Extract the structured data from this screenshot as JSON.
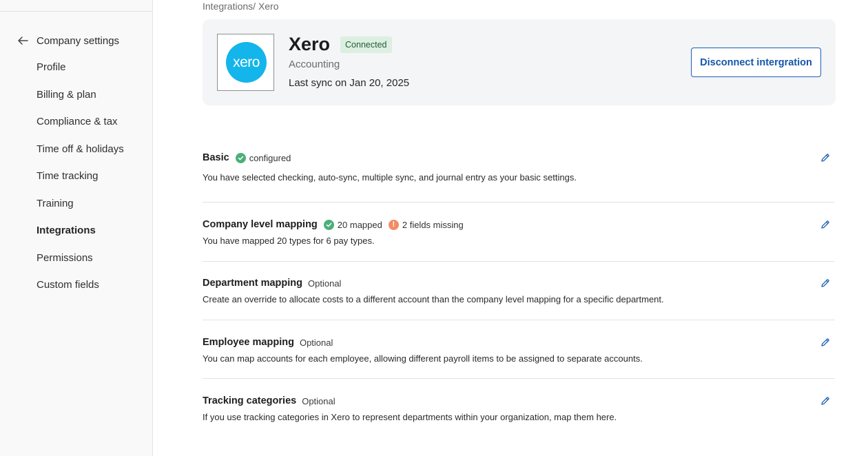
{
  "sidebar": {
    "back_label": "Company settings",
    "items": [
      {
        "label": "Profile"
      },
      {
        "label": "Billing & plan"
      },
      {
        "label": "Compliance & tax"
      },
      {
        "label": "Time off & holidays"
      },
      {
        "label": "Time tracking"
      },
      {
        "label": "Training"
      },
      {
        "label": "Integrations"
      },
      {
        "label": "Permissions"
      },
      {
        "label": "Custom fields"
      }
    ]
  },
  "breadcrumb": "Integrations/ Xero",
  "integration": {
    "logo_text": "xero",
    "name": "Xero",
    "badge": "Connected",
    "category": "Accounting",
    "last_sync": "Last sync on Jan 20, 2025",
    "disconnect_label": "Disconnect intergration"
  },
  "sections": [
    {
      "title": "Basic",
      "status_ok": "configured",
      "description": "You have selected checking, auto-sync, multiple sync, and journal entry as your basic settings."
    },
    {
      "title": "Company level mapping",
      "status_ok": "20 mapped",
      "status_warn_symbol": "!",
      "status_warn": "2 fields missing",
      "description": "You have mapped 20 types for 6 pay types."
    },
    {
      "title": "Department mapping",
      "meta": "Optional",
      "description": "Create an override to allocate costs to a different account than the company level mapping for a specific department."
    },
    {
      "title": "Employee mapping",
      "meta": "Optional",
      "description": "You can map accounts for each employee, allowing different payroll items to be assigned to separate accounts."
    },
    {
      "title": "Tracking categories",
      "meta": "Optional",
      "description": "If you use tracking categories in Xero to represent departments within your organization, map them here."
    }
  ],
  "colors": {
    "accent": "#1a5fb4",
    "success": "#4caf7a",
    "warning": "#f28b66",
    "xero_brand": "#13b5ea"
  }
}
